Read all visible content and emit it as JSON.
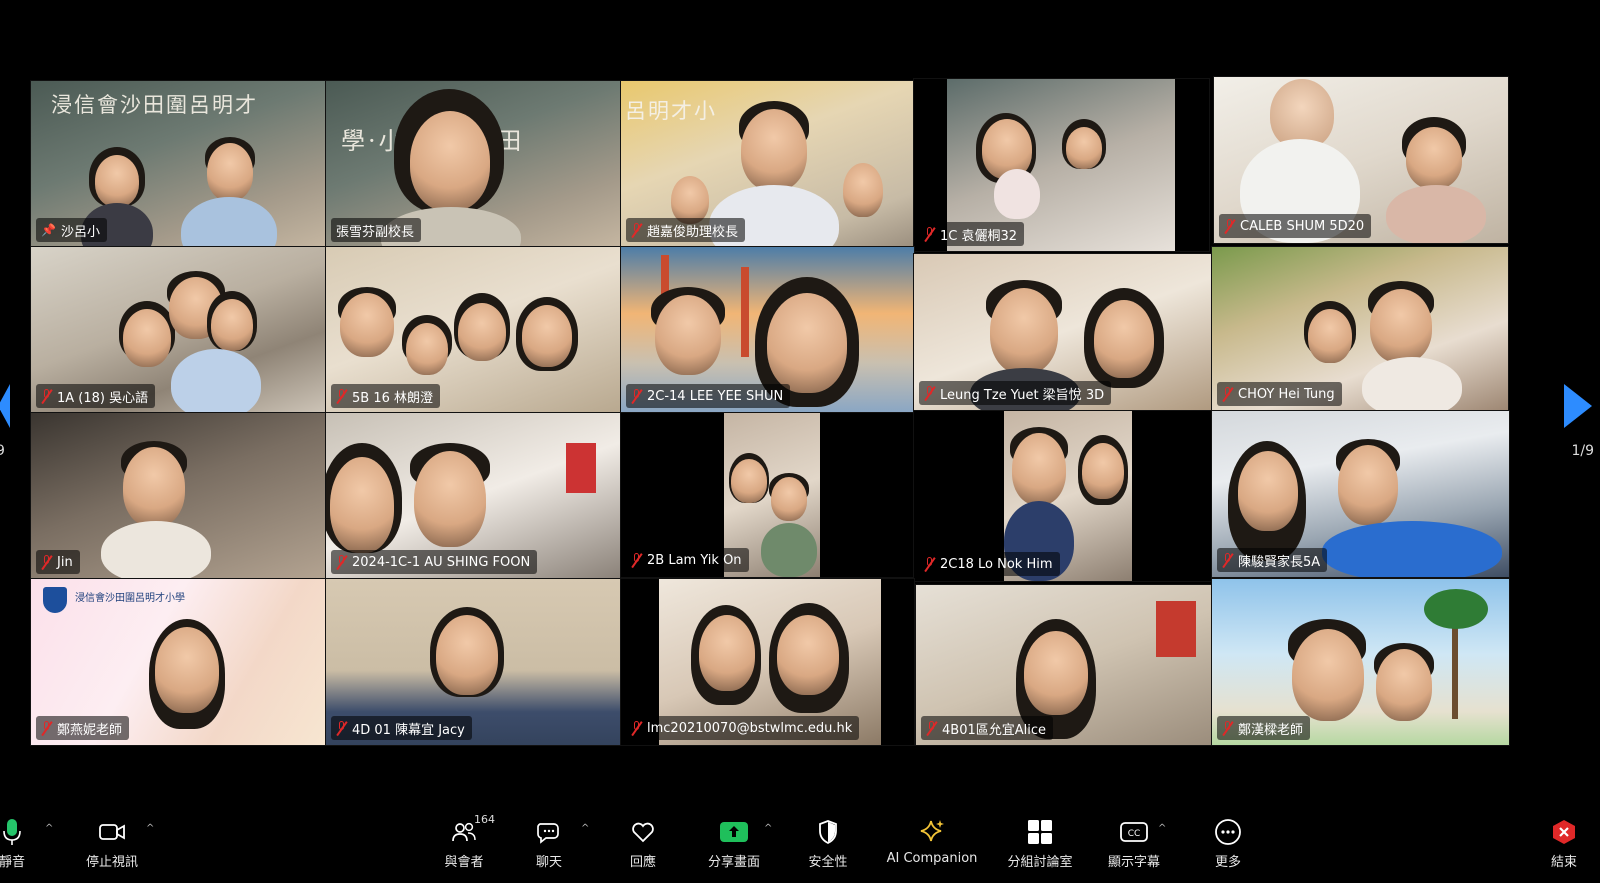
{
  "pagination": {
    "left_label": "9",
    "right_label": "1/9"
  },
  "tiles": [
    {
      "name": "沙呂小",
      "pinned": true
    },
    {
      "name": "張雪芬副校長"
    },
    {
      "name": "趙嘉俊助理校長"
    },
    {
      "name": "1C 袁儷桐32"
    },
    {
      "name": "CALEB SHUM 5D20"
    },
    {
      "name": "1A (18) 吳心語"
    },
    {
      "name": "5B 16 林朗澄"
    },
    {
      "name": "2C-14 LEE YEE SHUN"
    },
    {
      "name": "Leung Tze Yuet 梁旨悅 3D"
    },
    {
      "name": "CHOY Hei Tung"
    },
    {
      "name": "Jin"
    },
    {
      "name": "2024-1C-1 AU SHING FOON"
    },
    {
      "name": "2B Lam Yik On"
    },
    {
      "name": "2C18 Lo Nok Him"
    },
    {
      "name": "陳駿賢家長5A"
    },
    {
      "name": "鄭燕妮老師"
    },
    {
      "name": "4D 01 陳幕宜 Jacy"
    },
    {
      "name": "lmc20210070@bstwlmc.edu.hk"
    },
    {
      "name": "4B01區允宜Alice"
    },
    {
      "name": "鄭漢樑老師"
    }
  ],
  "backgrounds": {
    "wall_text_1": "浸信會沙田圍呂明才",
    "wall_text_2": "學·小學 呂圍田",
    "wall_text_3": "呂明才小",
    "banner_text": "浸信會沙田圍呂明才小學"
  },
  "toolbar": {
    "mute": "靜音",
    "stop_video": "停止視訊",
    "participants": "與會者",
    "participants_count": "164",
    "chat": "聊天",
    "reactions": "回應",
    "share": "分享畫面",
    "security": "安全性",
    "ai_companion": "AI Companion",
    "breakout": "分組討論室",
    "captions": "顯示字幕",
    "more": "更多",
    "end": "結束"
  },
  "colors": {
    "accent": "#2d8cff",
    "mic_active": "#25c46a",
    "muted_red": "#e02828",
    "share_green": "#1fbf5b",
    "ai_gold": "#f3c437",
    "end_red": "#e02828"
  }
}
